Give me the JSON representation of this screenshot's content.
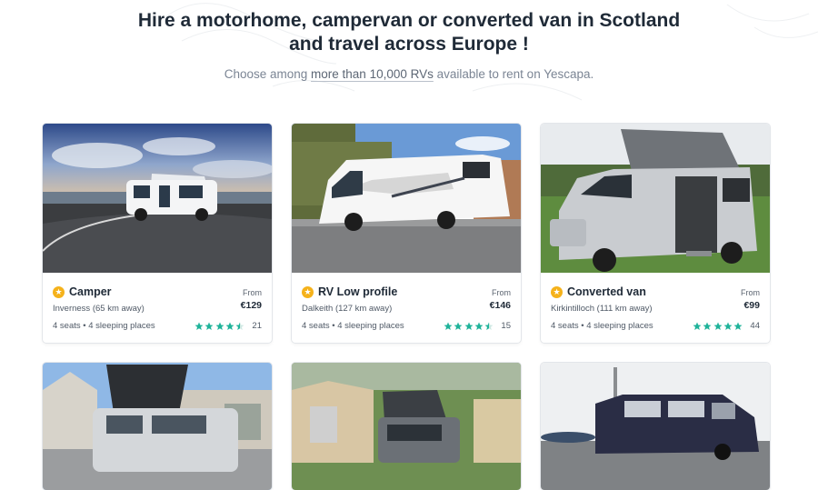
{
  "hero": {
    "title_line1": "Hire a motorhome, campervan or converted van in Scotland",
    "title_line2": "and travel across Europe !",
    "subtitle_pre": "Choose among ",
    "subtitle_link": "more than 10,000 RVs",
    "subtitle_post": " available to rent on Yescapa."
  },
  "colors": {
    "accent_star": "#f5b21b",
    "rating_green": "#1fb39a",
    "text_dark": "#1f2a37"
  },
  "listings": [
    {
      "type": "Camper",
      "location": "Inverness (65 km away)",
      "capacity": "4 seats • 4 sleeping places",
      "price_label": "From",
      "price": "€129",
      "rating": 4.5,
      "reviews": "21",
      "photo": "white pop-top campervan by a loch at sunset"
    },
    {
      "type": "RV Low profile",
      "location": "Dalkeith (127 km away)",
      "capacity": "4 seats • 4 sleeping places",
      "price_label": "From",
      "price": "€146",
      "rating": 4.5,
      "reviews": "15",
      "photo": "white low profile motorhome parked on street"
    },
    {
      "type": "Converted van",
      "location": "Kirkintilloch (111 km away)",
      "capacity": "4 seats • 4 sleeping places",
      "price_label": "From",
      "price": "€99",
      "rating": 5,
      "reviews": "44",
      "photo": "silver converted van with pop-top roof on grass"
    },
    {
      "photo": "silver pop-top campervan in front of houses"
    },
    {
      "photo": "grey campervan with pop-top in garden"
    },
    {
      "photo": "dark blue campervan on road"
    }
  ]
}
